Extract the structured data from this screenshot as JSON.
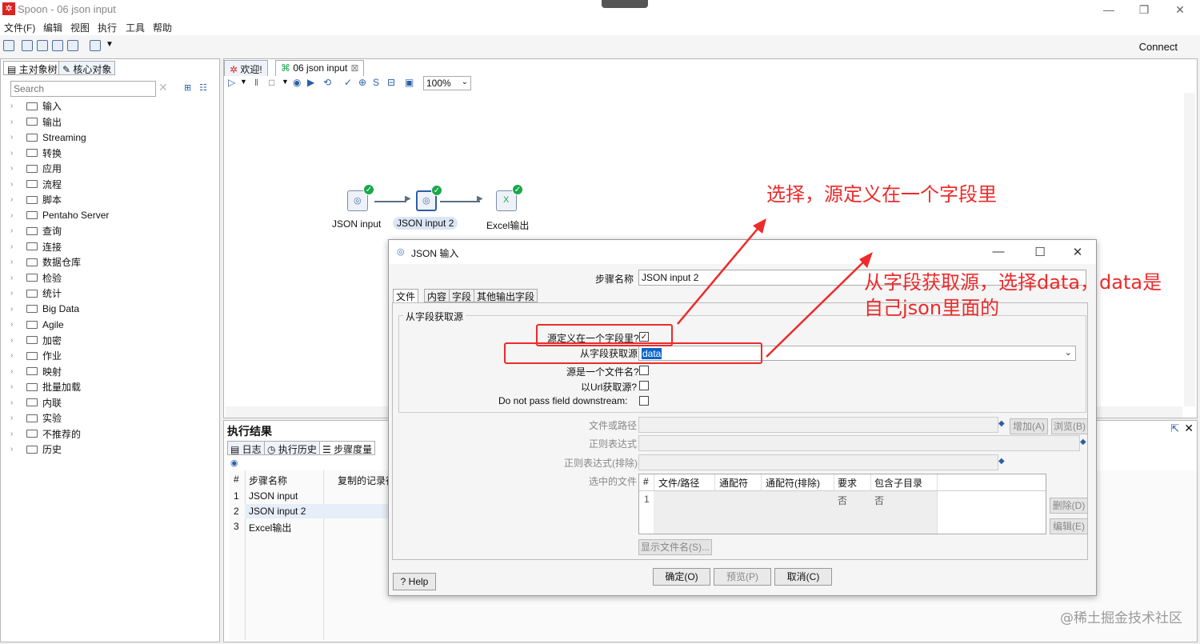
{
  "window": {
    "app_icon": "kettle-icon",
    "title": "Spoon - 06 json input"
  },
  "menu": [
    "文件(F)",
    "编辑",
    "视图",
    "执行",
    "工具",
    "帮助"
  ],
  "toolbar": {
    "connect_label": "Connect"
  },
  "left_panel": {
    "tabs": [
      "主对象树",
      "核心对象"
    ],
    "search_placeholder": "Search",
    "tree": [
      "输入",
      "输出",
      "Streaming",
      "转换",
      "应用",
      "流程",
      "脚本",
      "Pentaho Server",
      "查询",
      "连接",
      "数据仓库",
      "检验",
      "统计",
      "Big Data",
      "Agile",
      "加密",
      "作业",
      "映射",
      "批量加载",
      "内联",
      "实验",
      "不推荐的",
      "历史"
    ]
  },
  "editor": {
    "tabs": [
      "欢迎!",
      "06 json input"
    ],
    "zoom": "100%",
    "steps": [
      {
        "label": "JSON input",
        "selected": false
      },
      {
        "label": "JSON input 2",
        "selected": true
      },
      {
        "label": "Excel输出",
        "selected": false
      }
    ]
  },
  "results": {
    "title": "执行结果",
    "tabs": [
      "日志",
      "执行历史",
      "步骤度量"
    ],
    "headers": [
      "#",
      "步骤名称",
      "复制的记录行"
    ],
    "rows": [
      {
        "n": "1",
        "name": "JSON input"
      },
      {
        "n": "2",
        "name": "JSON input 2"
      },
      {
        "n": "3",
        "name": "Excel输出"
      }
    ]
  },
  "dialog": {
    "title": "JSON 输入",
    "stepname_label": "步骤名称",
    "stepname_value": "JSON input 2",
    "tabs": [
      "文件",
      "内容",
      "字段",
      "其他输出字段"
    ],
    "group_title": "从字段获取源",
    "src_in_field_label": "源定义在一个字段里?",
    "src_in_field_checked": true,
    "field_label": "从字段获取源",
    "field_value": "data",
    "src_is_file_label": "源是一个文件名?",
    "src_url_label": "以Url获取源?",
    "no_pass_label": "Do not pass field downstream:",
    "file_path_label": "文件或路径",
    "regex_label": "正则表达式",
    "regex_exclude_label": "正则表达式(排除)",
    "selected_files_label": "选中的文件",
    "add_btn": "增加(A)",
    "browse_btn": "浏览(B)",
    "delete_btn": "删除(D)",
    "edit_btn": "编辑(E)",
    "show_files_btn": "显示文件名(S)...",
    "table_headers": [
      "#",
      "文件/路径",
      "通配符",
      "通配符(排除)",
      "要求",
      "包含子目录"
    ],
    "table_row": {
      "n": "1",
      "required": "否",
      "subdirs": "否"
    },
    "ok_btn": "确定(O)",
    "preview_btn": "预览(P)",
    "cancel_btn": "取消(C)",
    "help_btn": "Help"
  },
  "annotations": {
    "note1": "选择，源定义在一个字段里",
    "note2_line1": "从字段获取源，选择data，data是",
    "note2_line2": "自己json里面的",
    "color": "#ee2a2a"
  },
  "watermark": "@稀土掘金技术社区"
}
